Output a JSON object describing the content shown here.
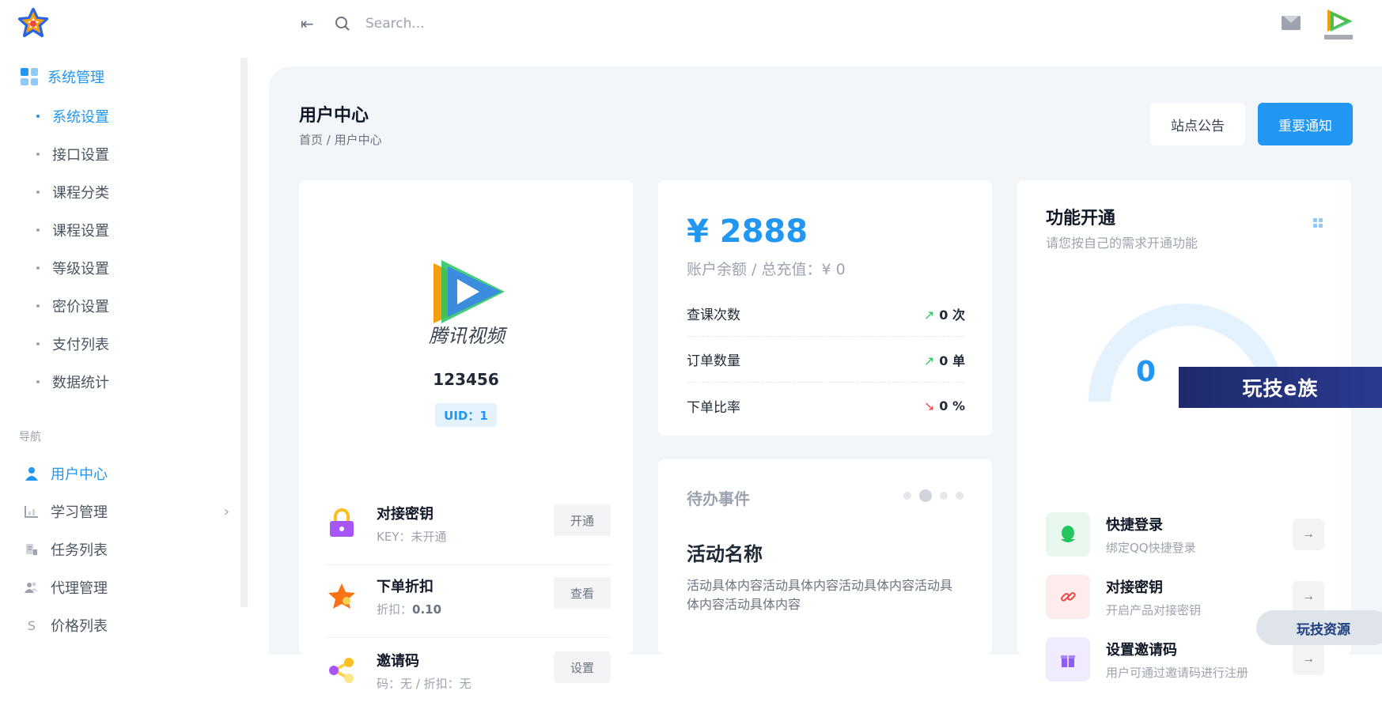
{
  "sidebar": {
    "group_label": "系统管理",
    "sub_items": [
      {
        "label": "系统设置",
        "active": true
      },
      {
        "label": "接口设置"
      },
      {
        "label": "课程分类"
      },
      {
        "label": "课程设置"
      },
      {
        "label": "等级设置"
      },
      {
        "label": "密价设置"
      },
      {
        "label": "支付列表"
      },
      {
        "label": "数据统计"
      }
    ],
    "section_label": "导航",
    "nav_items": [
      {
        "label": "用户中心",
        "icon": "user-icon",
        "active": true
      },
      {
        "label": "学习管理",
        "icon": "chart-icon",
        "has_submenu": true
      },
      {
        "label": "任务列表",
        "icon": "task-icon"
      },
      {
        "label": "代理管理",
        "icon": "agent-icon"
      },
      {
        "label": "价格列表",
        "icon": "dollar-icon",
        "glyph": "S"
      }
    ]
  },
  "topbar": {
    "search_placeholder": "Search..."
  },
  "header": {
    "title": "用户中心",
    "breadcrumb": "首页 / 用户中心",
    "notice_button": "站点公告",
    "important_button": "重要通知"
  },
  "profile": {
    "avatar_text": "腾讯视频",
    "username": "123456",
    "uid": "UID：1",
    "rows": [
      {
        "title": "对接密钥",
        "sub_label": "KEY：",
        "sub_value": "未开通",
        "action": "开通",
        "icon": "lock-icon"
      },
      {
        "title": "下单折扣",
        "sub_label": "折扣：",
        "sub_value": "0.10",
        "action": "查看",
        "icon": "star-icon"
      },
      {
        "title": "邀请码",
        "sub_label": "码：无 / 折扣：",
        "sub_value": "无",
        "action": "设置",
        "icon": "share-icon"
      }
    ]
  },
  "balance": {
    "amount": "¥ 2888",
    "subtitle": "账户余额 / 总充值：¥ 0",
    "stats": [
      {
        "label": "查课次数",
        "value": "0 次",
        "trend": "up"
      },
      {
        "label": "订单数量",
        "value": "0 单",
        "trend": "up"
      },
      {
        "label": "下单比率",
        "value": "0 %",
        "trend": "down"
      }
    ]
  },
  "todo": {
    "title": "待办事件",
    "activity_title": "活动名称",
    "activity_body": "活动具体内容活动具体内容活动具体内容活动具体内容活动具体内容"
  },
  "features": {
    "title": "功能开通",
    "subtitle": "请您按自己的需求开通功能",
    "gauge_value": "0",
    "gauge_level": 0,
    "items": [
      {
        "title": "快捷登录",
        "subtitle": "绑定QQ快捷登录",
        "icon": "qq-icon",
        "color": "#22c55e",
        "bg": "#e8f8ee"
      },
      {
        "title": "对接密钥",
        "subtitle": "开启产品对接密钥",
        "icon": "link-icon",
        "color": "#ef4444",
        "bg": "#fdecec"
      },
      {
        "title": "设置邀请码",
        "subtitle": "用户可通过邀请码进行注册",
        "icon": "gift-icon",
        "color": "#8b5cf6",
        "bg": "#f1ecfd"
      }
    ]
  },
  "overlays": {
    "banner": "玩技e族",
    "pill": "玩技资源"
  },
  "colors": {
    "accent": "#2196f3",
    "background": "#f3f6f9"
  }
}
